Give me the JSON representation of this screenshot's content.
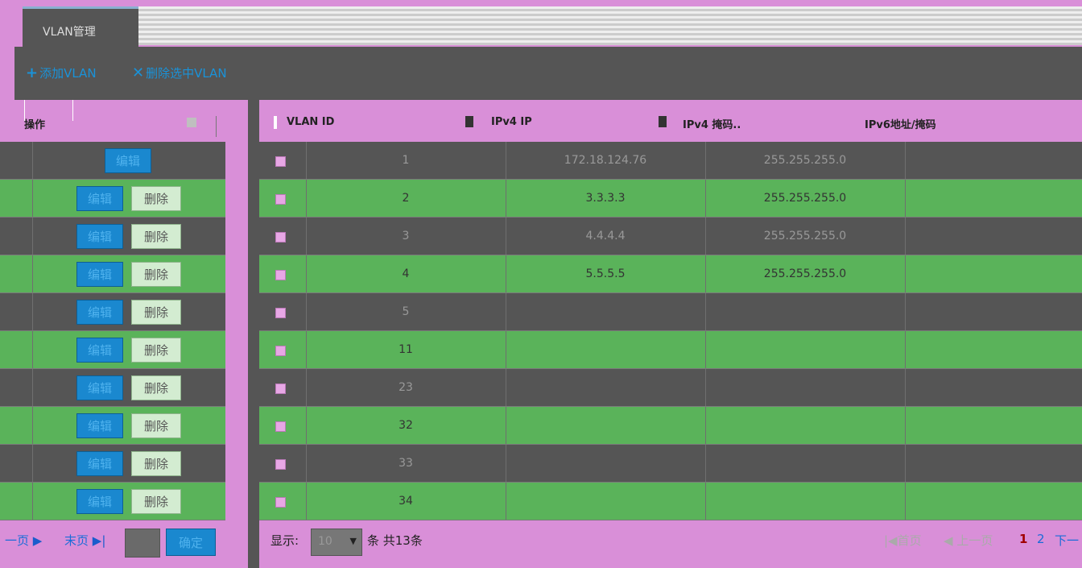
{
  "tab": {
    "label": "VLAN管理"
  },
  "toolbar": {
    "add_label": "添加VLAN",
    "delete_label": "删除选中VLAN"
  },
  "left_table": {
    "header": "操作",
    "edit_label": "编辑",
    "delete_label": "删除",
    "rows": [
      {
        "has_delete": false
      },
      {
        "has_delete": true
      },
      {
        "has_delete": true
      },
      {
        "has_delete": true
      },
      {
        "has_delete": true
      },
      {
        "has_delete": true
      },
      {
        "has_delete": true
      },
      {
        "has_delete": true
      },
      {
        "has_delete": true
      },
      {
        "has_delete": true
      }
    ]
  },
  "right_table": {
    "headers": [
      "VLAN ID",
      "IPv4 IP",
      "IPv4 掩码..",
      "IPv6地址/掩码"
    ],
    "rows": [
      {
        "vlan_id": "1",
        "ipv4": "172.18.124.76",
        "mask": "255.255.255.0",
        "ipv6": ""
      },
      {
        "vlan_id": "2",
        "ipv4": "3.3.3.3",
        "mask": "255.255.255.0",
        "ipv6": ""
      },
      {
        "vlan_id": "3",
        "ipv4": "4.4.4.4",
        "mask": "255.255.255.0",
        "ipv6": ""
      },
      {
        "vlan_id": "4",
        "ipv4": "5.5.5.5",
        "mask": "255.255.255.0",
        "ipv6": ""
      },
      {
        "vlan_id": "5",
        "ipv4": "",
        "mask": "",
        "ipv6": ""
      },
      {
        "vlan_id": "11",
        "ipv4": "",
        "mask": "",
        "ipv6": ""
      },
      {
        "vlan_id": "23",
        "ipv4": "",
        "mask": "",
        "ipv6": ""
      },
      {
        "vlan_id": "32",
        "ipv4": "",
        "mask": "",
        "ipv6": ""
      },
      {
        "vlan_id": "33",
        "ipv4": "",
        "mask": "",
        "ipv6": ""
      },
      {
        "vlan_id": "34",
        "ipv4": "",
        "mask": "",
        "ipv6": ""
      }
    ]
  },
  "pager_left": {
    "next_label": "一页",
    "last_label": "末页",
    "confirm_label": "确定",
    "page_input": ""
  },
  "pager_right": {
    "show_label": "显示:",
    "page_size": "10",
    "total_label": "条 共13条",
    "first_label": "首页",
    "prev_label": "上一页",
    "pages": [
      "1",
      "2"
    ],
    "current_page": "1",
    "next_label": "下一"
  },
  "colors": {
    "accent": "#1a88cf",
    "header_bg": "#d98fd8",
    "row_dark": "#555555",
    "row_green": "#5ab35a"
  }
}
